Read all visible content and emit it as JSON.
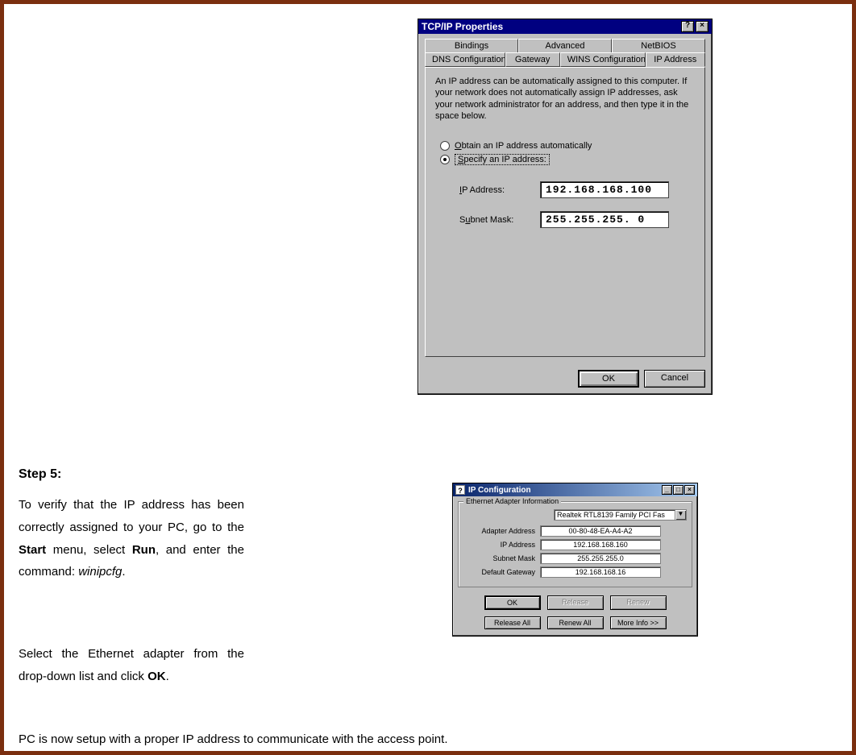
{
  "dialog1": {
    "title": "TCP/IP Properties",
    "help_btn": "?",
    "close_btn": "×",
    "tabs_row1": [
      "Bindings",
      "Advanced",
      "NetBIOS"
    ],
    "tabs_row2": [
      "DNS Configuration",
      "Gateway",
      "WINS Configuration",
      "IP Address"
    ],
    "active_tab": "IP Address",
    "helptext": "An IP address can be automatically assigned to this computer. If your network does not automatically assign IP addresses, ask your network administrator for an address, and then type it in the space below.",
    "radio_auto": "Obtain an IP address automatically",
    "radio_specify": "Specify an IP address:",
    "fields": {
      "ip_label": "IP Address:",
      "ip_value": "192.168.168.100",
      "mask_label": "Subnet Mask:",
      "mask_value": "255.255.255.  0"
    },
    "ok": "OK",
    "cancel": "Cancel"
  },
  "step": {
    "heading": "Step 5:",
    "para1_prefix": "To verify that the IP address has been correctly assigned to your PC, go to the ",
    "start": "Start",
    "para1_mid": " menu, select ",
    "run": "Run",
    "para1_mid2": ", and enter the command: ",
    "cmd": "winipcfg",
    "para1_suffix": ".",
    "para2_prefix": "Select the Ethernet adapter from the drop-down list and click ",
    "ok": "OK",
    "para2_suffix": ".",
    "para3": "PC is now setup with a proper IP address to communicate with the access point."
  },
  "dialog2": {
    "title": "IP Configuration",
    "min": "_",
    "max": "□",
    "close": "×",
    "group_title": "Ethernet Adapter Information",
    "adapter_value": "Realtek RTL8139 Family PCI Fas",
    "rows": {
      "adapter_addr_label": "Adapter Address",
      "adapter_addr_value": "00-80-48-EA-A4-A2",
      "ip_label": "IP Address",
      "ip_value": "192.168.168.160",
      "mask_label": "Subnet Mask",
      "mask_value": "255.255.255.0",
      "gw_label": "Default Gateway",
      "gw_value": "192.168.168.16"
    },
    "buttons": {
      "ok": "OK",
      "release": "Release",
      "renew": "Renew",
      "release_all": "Release All",
      "renew_all": "Renew All",
      "more_info": "More Info >>"
    }
  }
}
